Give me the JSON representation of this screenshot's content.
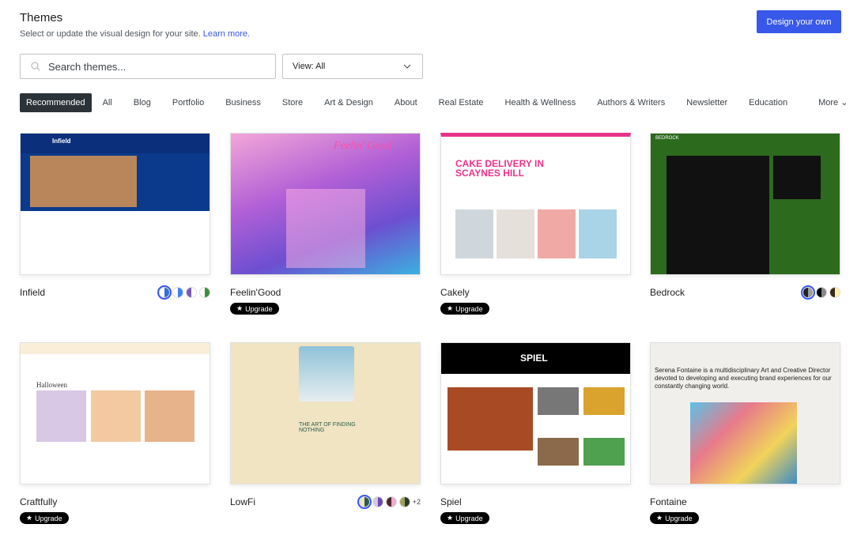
{
  "header": {
    "title": "Themes",
    "subtitle": "Select or update the visual design for your site.",
    "learn_more": "Learn more.",
    "design_button": "Design your own"
  },
  "search": {
    "placeholder": "Search themes...",
    "value": ""
  },
  "view": {
    "label": "View: All"
  },
  "tabs": [
    "Recommended",
    "All",
    "Blog",
    "Portfolio",
    "Business",
    "Store",
    "Art & Design",
    "About",
    "Real Estate",
    "Health & Wellness",
    "Authors & Writers",
    "Newsletter",
    "Education"
  ],
  "more_label": "More",
  "upgrade_label": "Upgrade",
  "themes": [
    {
      "name": "Infield",
      "upgrade": false,
      "swatches": [
        [
          "#ffffff",
          "#2f6fde"
        ],
        [
          "#ffffff",
          "#3b82f6"
        ],
        [
          "#7b5bb6",
          "#ffffff"
        ],
        [
          "#ffffff",
          "#3a8d3a"
        ]
      ],
      "thumb_text": "Infield"
    },
    {
      "name": "Feelin'Good",
      "upgrade": true,
      "thumb_text": "Feelin' Good"
    },
    {
      "name": "Cakely",
      "upgrade": true,
      "thumb_text": "CAKE DELIVERY IN SCAYNES HILL"
    },
    {
      "name": "Bedrock",
      "upgrade": false,
      "swatches": [
        [
          "#222222",
          "#9e9e9e"
        ],
        [
          "#000000",
          "#888888"
        ],
        [
          "#3b2a1a",
          "#fff2a8"
        ]
      ],
      "thumb_text": "BEDROCK"
    },
    {
      "name": "Craftfully",
      "upgrade": true,
      "thumb_text": "Halloween"
    },
    {
      "name": "LowFi",
      "upgrade": false,
      "swatches": [
        [
          "#efe4c0",
          "#2d5a4f"
        ],
        [
          "#d6c6ea",
          "#6a4aa8"
        ],
        [
          "#4a2a2a",
          "#f0a8d0"
        ],
        [
          "#a0a060",
          "#2a3a2a"
        ]
      ],
      "extra": "+2",
      "thumb_text": "THE ART OF FINDING NOTHING"
    },
    {
      "name": "Spiel",
      "upgrade": true,
      "thumb_text": "SPIEL"
    },
    {
      "name": "Fontaine",
      "upgrade": true,
      "thumb_text": "Serena Fontaine is a multidisciplinary Art and Creative Director devoted to developing and executing brand experiences for our constantly changing world."
    }
  ],
  "colors": {
    "accent": "#3858e9",
    "active_tab": "#2c3338"
  }
}
